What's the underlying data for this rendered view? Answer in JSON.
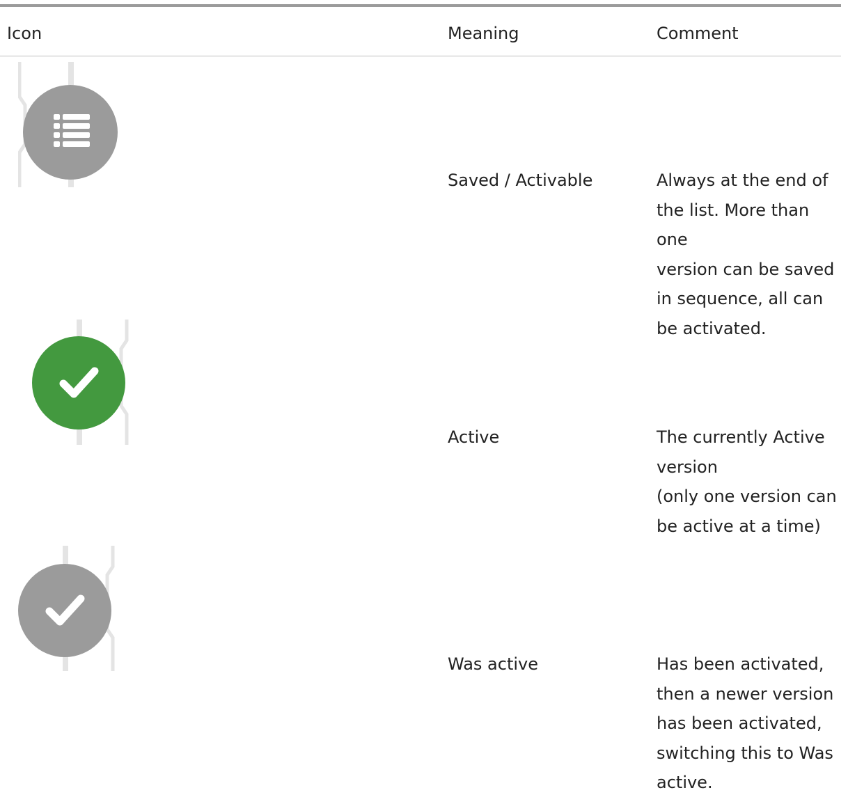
{
  "table": {
    "headers": {
      "icon": "Icon",
      "meaning": "Meaning",
      "comment": "Comment"
    },
    "rows": [
      {
        "icon": "list-icon",
        "icon_color": "#9b9b9b",
        "meaning": "Saved / Activable",
        "comment": "Always at the end of\nthe list. More than one\nversion can be saved\nin sequence, all can\nbe activated."
      },
      {
        "icon": "check-icon",
        "icon_color": "#43993f",
        "meaning": "Active",
        "comment": "The currently Active\nversion\n(only one version can\nbe active at a time)"
      },
      {
        "icon": "check-icon",
        "icon_color": "#9b9b9b",
        "meaning": "Was active",
        "comment": "Has been activated,\nthen a newer version\nhas been activated,\nswitching this to Was\nactive."
      }
    ]
  }
}
